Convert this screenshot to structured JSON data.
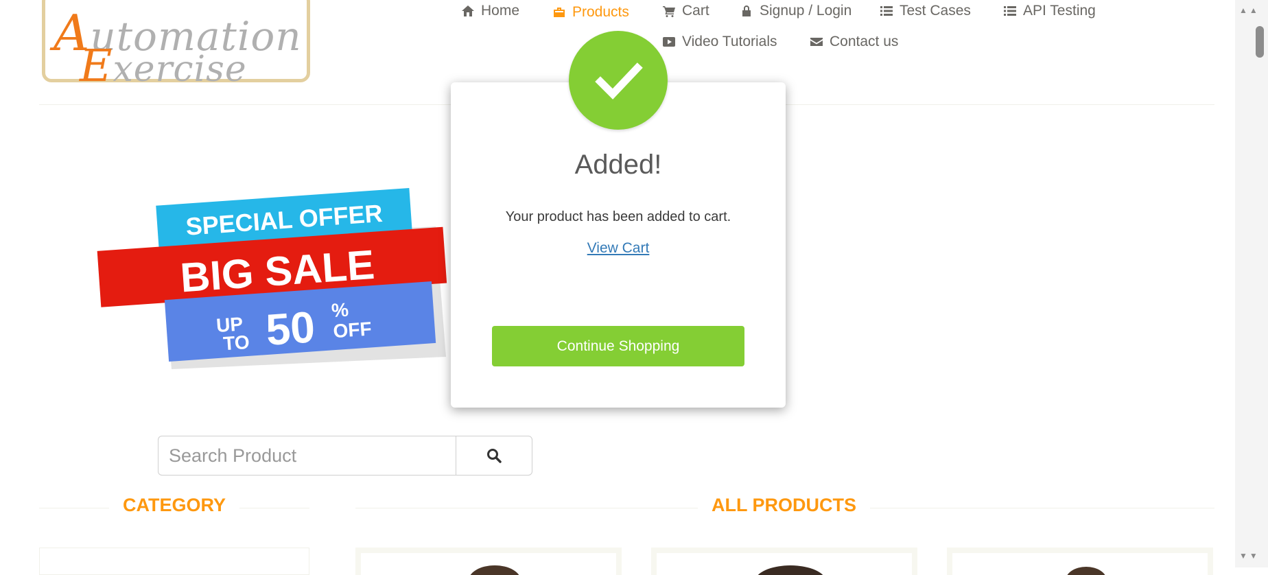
{
  "logo": {
    "line1": "Automation",
    "line2": "Exercise"
  },
  "nav": {
    "home": "Home",
    "products": "Products",
    "cart": "Cart",
    "login": "Signup / Login",
    "test_cases": "Test Cases",
    "api_testing": "API Testing",
    "video_tutorials": "Video Tutorials",
    "contact": "Contact us",
    "active_color": "#fe980f"
  },
  "banner": {
    "line1": "SPECIAL OFFER",
    "line2": "BIG SALE",
    "up": "UP",
    "to": "TO",
    "amount": "50",
    "percent": "%",
    "off": "OFF"
  },
  "search": {
    "placeholder": "Search Product"
  },
  "sections": {
    "category": "CATEGORY",
    "all_products": "ALL PRODUCTS"
  },
  "modal": {
    "title": "Added!",
    "message": "Your product has been added to cart.",
    "view_cart": "View Cart",
    "continue": "Continue Shopping",
    "accent": "#84ce34"
  }
}
